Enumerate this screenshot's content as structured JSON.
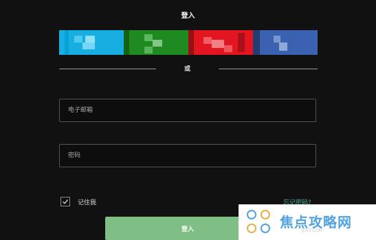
{
  "header": {
    "title": "登入"
  },
  "social": {
    "buttons": [
      {
        "name": "social-login-1",
        "color": "#17aee2"
      },
      {
        "name": "social-login-2",
        "color": "#1f8a1f"
      },
      {
        "name": "social-login-3",
        "color": "#e21520"
      },
      {
        "name": "social-login-4",
        "color": "#3a62b0"
      }
    ]
  },
  "divider": {
    "text": "或"
  },
  "form": {
    "email_placeholder": "电子邮箱",
    "password_placeholder": "密码",
    "remember_label": "记住我",
    "remember_checked": true,
    "forgot_link": "忘记密码?",
    "login_label": "登入"
  },
  "watermark": {
    "text": "焦点攻略网",
    "sub": "JDFZ.COM"
  },
  "colors": {
    "background": "#111111",
    "primary_button": "#7fbf85",
    "link": "#4fb3a0"
  }
}
